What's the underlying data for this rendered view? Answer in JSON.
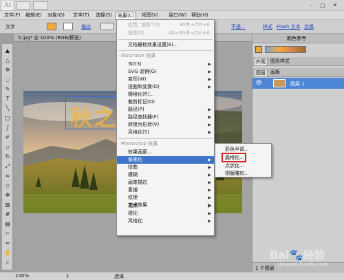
{
  "app": {
    "logo_text": "Ai"
  },
  "menubar": {
    "items": [
      "文件(F)",
      "编辑(E)",
      "对象(O)",
      "文字(T)",
      "选择(S)",
      "效果(C)",
      "视图(V)",
      "窗口(W)",
      "帮助(H)"
    ],
    "active_index": 5
  },
  "control_bar": {
    "label": "文字",
    "stroke_label": "描边",
    "opacity": "不透...",
    "links": [
      "样式",
      "Flash 文本",
      "变换"
    ]
  },
  "document": {
    "tab_title": "5.jpg* @ 100% (RGB/预览)",
    "artboard_text": "秋之"
  },
  "effect_menu": {
    "top": [
      {
        "label": "应用 \"投影\"(A)",
        "shortcut": "Shift+Ctrl+E",
        "disabled": true
      },
      {
        "label": "投影(E)...",
        "shortcut": "Alt+Shift+Ctrl+E",
        "disabled": true
      }
    ],
    "doc_settings": "文档栅格效果设置(E)...",
    "illustrator_header": "Illustrator 效果",
    "illustrator_items": [
      "3D(3)",
      "SVG 滤镜(G)",
      "变形(W)",
      "扭曲和变换(D)",
      "栅格化(R)...",
      "裁剪标记(O)",
      "路径(P)",
      "路径查找器(F)",
      "转换为形状(V)",
      "风格化(S)"
    ],
    "photoshop_header": "Photoshop 效果",
    "photoshop_items": [
      "效果画廊...",
      "像素化",
      "扭曲",
      "模糊",
      "画笔描边",
      "素描",
      "纹理",
      "艺术效果",
      "视频",
      "锐化",
      "风格化"
    ],
    "highlighted": "像素化"
  },
  "pixelate_submenu": {
    "items": [
      "彩色半调...",
      "晶格化...",
      "点状化...",
      "铜版雕刻..."
    ],
    "highlighted": "晶格化..."
  },
  "panels": {
    "tabs_top": [
      "外观",
      "图形样式"
    ],
    "tabs_layers": [
      "图层",
      "画板"
    ],
    "swatch_tab": "颜色参考",
    "layer_name": "图层 1",
    "layer_count": "1 个图层"
  },
  "statusbar": {
    "zoom": "100%",
    "page": "1",
    "mode": "选择"
  },
  "watermark": {
    "logo": "Bai",
    "logo2": "经验",
    "url": "jingyan.baidu.com"
  },
  "colors": {
    "accent": "#3c74c8",
    "highlight_box": "#d42020",
    "text_orange": "#f1b43c"
  }
}
